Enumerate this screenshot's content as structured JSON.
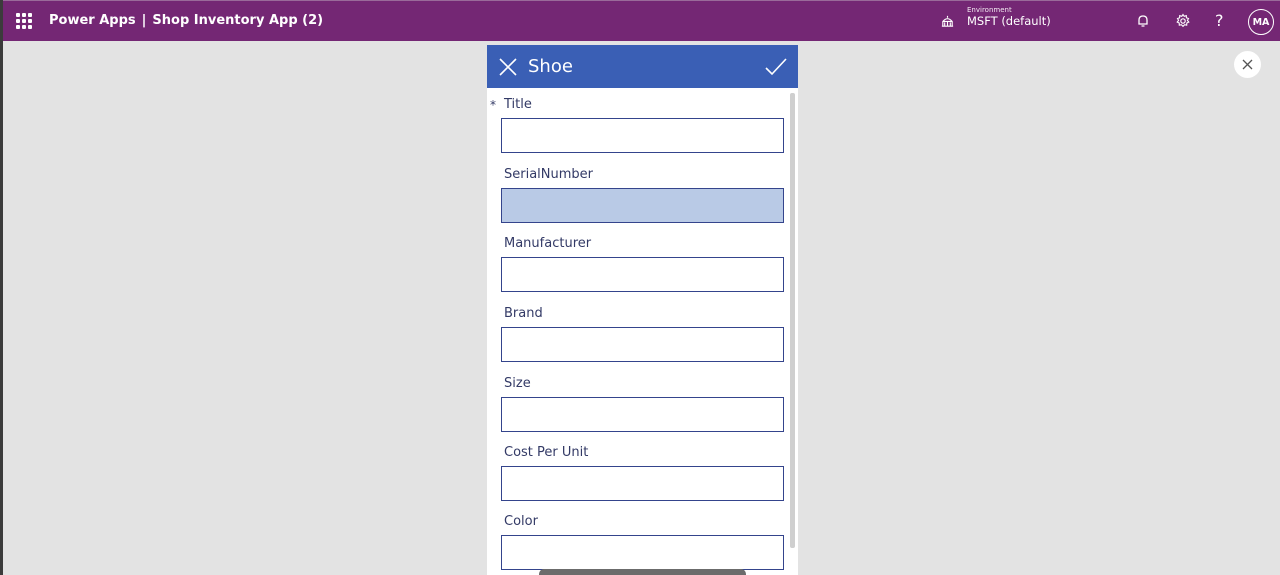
{
  "topbar": {
    "brand": "Power Apps",
    "separator": "|",
    "app_name": "Shop Inventory App (2)",
    "environment_label": "Environment",
    "environment_value": "MSFT (default)",
    "help_glyph": "?",
    "avatar_initials": "MA",
    "background_color": "#742774"
  },
  "form": {
    "title": "Shoe",
    "header_color": "#3a5fb5",
    "required_marker": "*",
    "fields": [
      {
        "label": "Title",
        "value": "",
        "required": true,
        "focused": false
      },
      {
        "label": "SerialNumber",
        "value": "",
        "required": false,
        "focused": true
      },
      {
        "label": "Manufacturer",
        "value": "",
        "required": false,
        "focused": false
      },
      {
        "label": "Brand",
        "value": "",
        "required": false,
        "focused": false
      },
      {
        "label": "Size",
        "value": "",
        "required": false,
        "focused": false
      },
      {
        "label": "Cost Per Unit",
        "value": "",
        "required": false,
        "focused": false
      },
      {
        "label": "Color",
        "value": "",
        "required": false,
        "focused": false
      }
    ]
  },
  "icons": {
    "waffle": "app-launcher-icon",
    "environment": "environment-icon",
    "notifications": "bell-icon",
    "settings": "gear-icon",
    "help": "help-icon",
    "close_preview": "close-icon",
    "form_cancel": "close-icon",
    "form_submit": "checkmark-icon"
  }
}
